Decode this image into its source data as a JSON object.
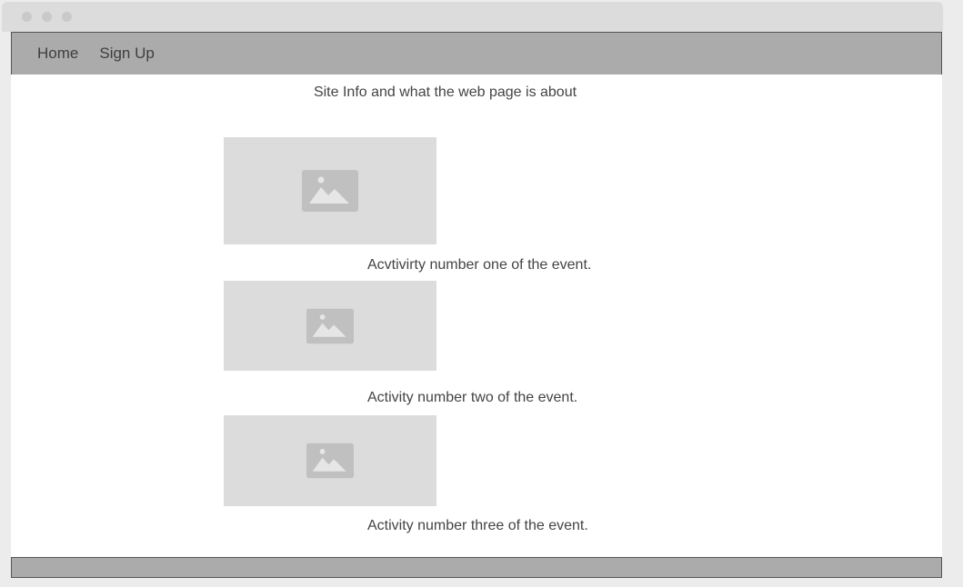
{
  "nav": {
    "items": [
      {
        "label": "Home"
      },
      {
        "label": "Sign Up"
      }
    ]
  },
  "main": {
    "site_info": "Site Info and what the web page is about",
    "activities": [
      {
        "image_icon": "image-placeholder-icon",
        "caption": "Acvtivirty number one of the event."
      },
      {
        "image_icon": "image-placeholder-icon",
        "caption": "Activity number two of the event."
      },
      {
        "image_icon": "image-placeholder-icon",
        "caption": "Activity number three of the event."
      }
    ]
  },
  "colors": {
    "window_bg": "#ececec",
    "titlebar": "#dcdcdc",
    "nav_bg": "#ababab",
    "content_bg": "#ffffff",
    "placeholder_bg": "#dcdcdc",
    "placeholder_icon": "#c0c0c0",
    "text": "#444444"
  }
}
